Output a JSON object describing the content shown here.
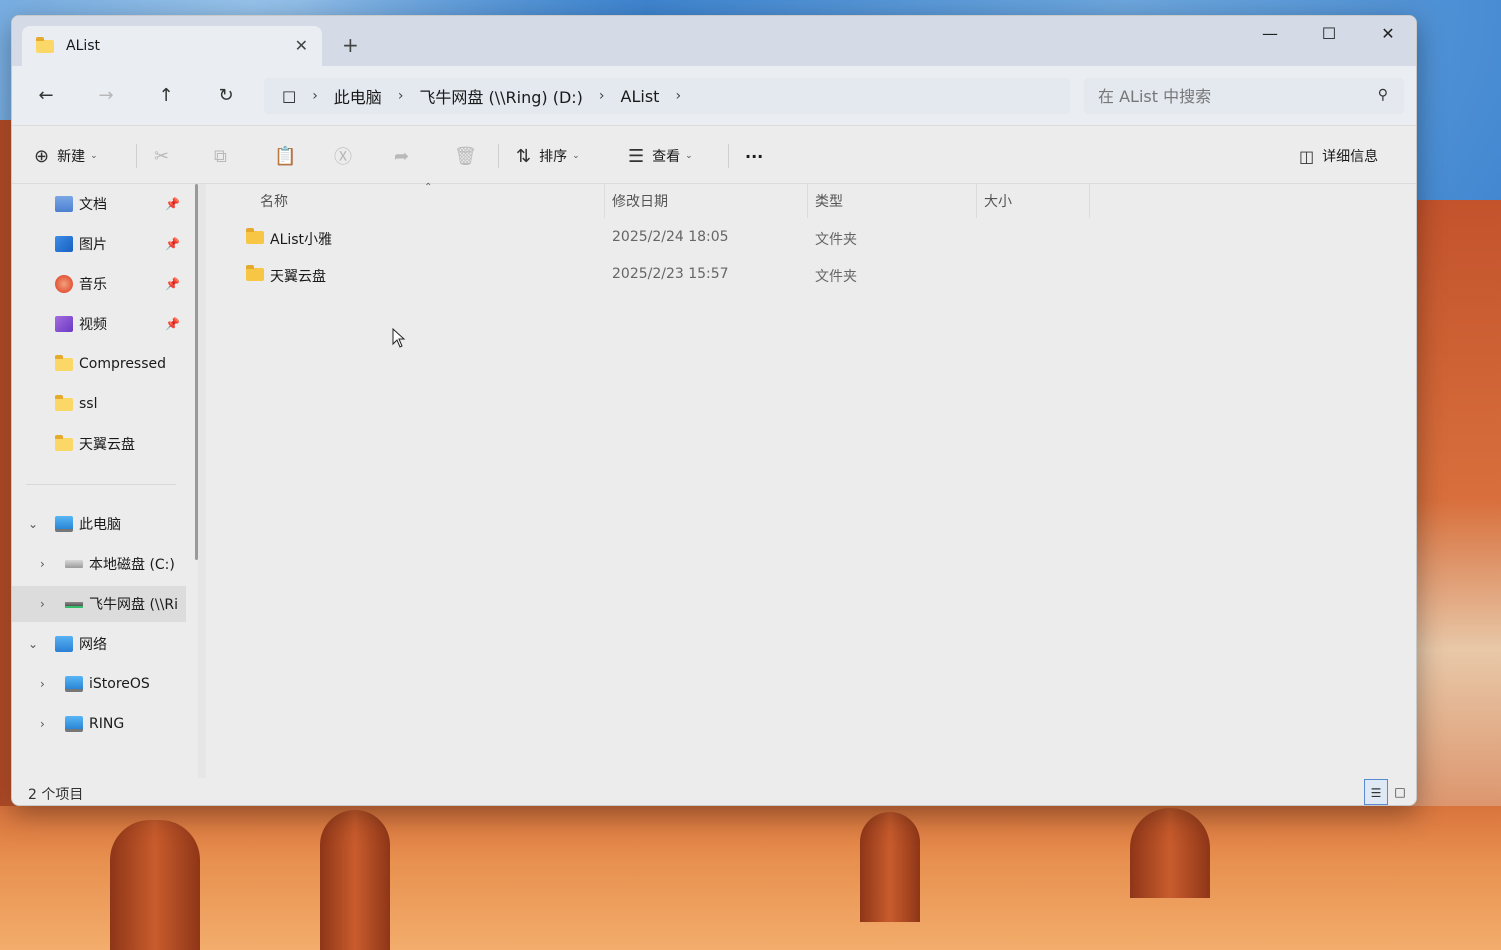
{
  "window": {
    "tab_title": "AList",
    "minimize": "—",
    "maximize": "☐",
    "close": "✕",
    "new_tab": "+"
  },
  "address": {
    "crumbs": [
      "此电脑",
      "飞牛网盘 (\\\\Ring) (D:)",
      "AList"
    ],
    "search_placeholder": "在 AList 中搜索"
  },
  "toolbar": {
    "new_label": "新建",
    "sort_label": "排序",
    "view_label": "查看",
    "more": "···",
    "details_label": "详细信息"
  },
  "sidebar": {
    "quick": [
      {
        "label": "文档",
        "icon": "documents-icon",
        "pinned": true
      },
      {
        "label": "图片",
        "icon": "pictures-icon",
        "pinned": true
      },
      {
        "label": "音乐",
        "icon": "music-icon",
        "pinned": true
      },
      {
        "label": "视频",
        "icon": "videos-icon",
        "pinned": true
      },
      {
        "label": "Compressed",
        "icon": "folder-icon",
        "pinned": false
      },
      {
        "label": "ssl",
        "icon": "folder-icon",
        "pinned": false
      },
      {
        "label": "天翼云盘",
        "icon": "folder-icon",
        "pinned": false
      }
    ],
    "this_pc": "此电脑",
    "drives": [
      {
        "label": "本地磁盘 (C:)"
      },
      {
        "label": "飞牛网盘 (\\\\Ri",
        "selected": true
      }
    ],
    "network": "网络",
    "network_items": [
      {
        "label": "iStoreOS"
      },
      {
        "label": "RING"
      }
    ]
  },
  "columns": {
    "name": "名称",
    "modified": "修改日期",
    "type": "类型",
    "size": "大小"
  },
  "files": [
    {
      "name": "AList小雅",
      "modified": "2025/2/24 18:05",
      "type": "文件夹"
    },
    {
      "name": "天翼云盘",
      "modified": "2025/2/23 15:57",
      "type": "文件夹"
    }
  ],
  "status": {
    "item_count": "2 个项目"
  },
  "colors": {
    "accent": "#2e6dbf",
    "folder": "#f7c644",
    "titlebar": "#d4dbe6"
  }
}
